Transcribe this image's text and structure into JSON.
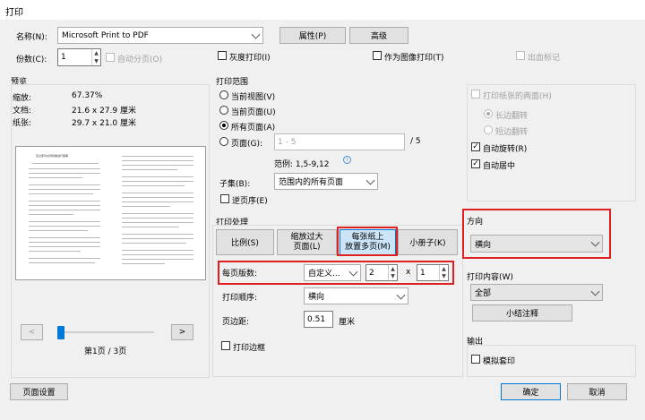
{
  "window": {
    "title": "打印"
  },
  "printer": {
    "name_label": "名称(N):",
    "name_value": "Microsoft Print to PDF",
    "properties_button": "属性(P)",
    "advanced_button": "高级",
    "copies_label": "份数(C):",
    "copies_value": "1",
    "collate_label": "自动分页(O)",
    "grayscale_label": "灰度打印(I)",
    "print_as_image_label": "作为图像打印(T)",
    "bleed_marks_label": "出血标记"
  },
  "preview": {
    "heading": "预览",
    "scale_label": "缩放:",
    "scale_value": "67.37%",
    "document_label": "文档:",
    "document_value": "21.6 x 27.9 厘米",
    "paper_label": "纸张:",
    "paper_value": "29.7 x 21.0 厘米",
    "prev_button": "<",
    "next_button": ">",
    "page_indicator": "第1页 / 3页",
    "slider_level": 0,
    "page_title_text": "应立即对台风防御进行部署"
  },
  "print_range": {
    "heading": "打印范围",
    "current_view": "当前视图(V)",
    "current_page": "当前页面(U)",
    "all_pages": "所有页面(A)",
    "pages": "页面(G):",
    "pages_placeholder": "1 - 5",
    "pages_total": "/ 5",
    "example": "范例: 1,5-9,12",
    "info_icon": "info-icon",
    "subset_label": "子集(B):",
    "subset_value": "范围内的所有页面",
    "reverse_label": "逆页序(E)"
  },
  "handling": {
    "heading": "打印处理",
    "scale_button": "比例(S)",
    "shrink_button_line1": "缩放过大",
    "shrink_button_line2": "页面(L)",
    "multiple_button_line1": "每张纸上",
    "multiple_button_line2": "放置多页(M)",
    "booklet_button": "小册子(K)",
    "pages_per_sheet_label": "每页版数:",
    "pages_per_sheet_value": "自定义...",
    "cols_value": "2",
    "times": "x",
    "rows_value": "1",
    "order_label": "打印顺序:",
    "order_value": "横向",
    "margin_label": "页边距:",
    "margin_value": "0.51",
    "margin_unit": "厘米",
    "border_label": "打印边框"
  },
  "duplex": {
    "both_sides_label": "打印纸张的两面(H)",
    "long_edge_label": "长边翻转",
    "short_edge_label": "短边翻转",
    "auto_rotate_label": "自动旋转(R)",
    "auto_center_label": "自动居中"
  },
  "orientation": {
    "heading": "方向",
    "value": "横向"
  },
  "content": {
    "heading": "打印内容(W)",
    "value": "全部",
    "summarize_button": "小结注释"
  },
  "output": {
    "heading": "输出",
    "simulate_overprint_label": "模拟套印"
  },
  "footer": {
    "page_setup_button": "页面设置",
    "ok_button": "确定",
    "cancel_button": "取消"
  },
  "colors": {
    "highlight_border": "#e02020",
    "selected_button_bg": "#cce4f7",
    "accent": "#0078d7"
  }
}
